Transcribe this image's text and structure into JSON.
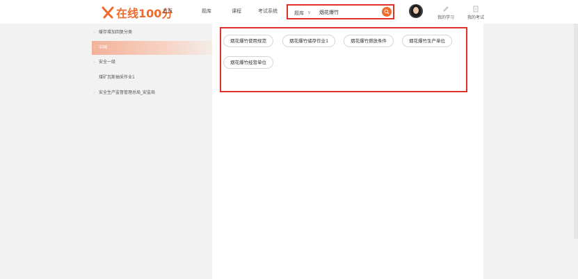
{
  "header": {
    "logo_text": "在线100分",
    "nav": [
      "首页",
      "题库",
      "课程",
      "考试系统"
    ],
    "search": {
      "scope": "题库",
      "value": "烟花爆竹"
    },
    "tools": [
      {
        "label": "我的学习",
        "icon": "pen-icon"
      },
      {
        "label": "我的考试",
        "icon": "document-icon"
      }
    ],
    "accent": "#f36b2c",
    "highlight": "#e0302a"
  },
  "sidebar": {
    "items": [
      {
        "label": "缓存增加回复分类",
        "arrow": "›",
        "active": false
      },
      {
        "label": "中国",
        "arrow": "›",
        "active": true
      },
      {
        "label": "安全一级",
        "arrow": "›",
        "active": false
      },
      {
        "label": "煤矿瓦斯抽采作业1",
        "arrow": "",
        "active": false
      },
      {
        "label": "安全生产监督管理总局_安监局",
        "arrow": "›",
        "active": false
      }
    ]
  },
  "main": {
    "tags": [
      "烟花爆竹使用规范",
      "烟花爆竹储存作业1",
      "烟花爆竹燃放条件",
      "烟花爆竹生产单位",
      "烟花爆竹经营单位"
    ]
  }
}
